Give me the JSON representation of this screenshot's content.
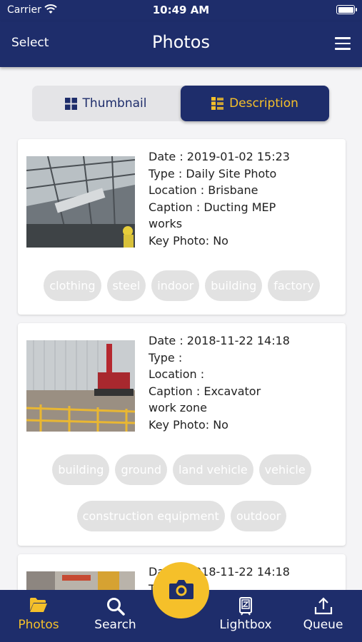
{
  "status_bar": {
    "carrier": "Carrier",
    "time": "10:49 AM"
  },
  "nav": {
    "left_label": "Select",
    "title": "Photos",
    "menu_icon": "hamburger-menu-icon"
  },
  "view_toggle": {
    "thumbnail_label": "Thumbnail",
    "description_label": "Description",
    "selected": "Description"
  },
  "photos": [
    {
      "date": "Date : 2019-01-02 15:23",
      "type": "Type : Daily Site Photo",
      "location": "Location : Brisbane",
      "caption_line1": "Caption : Ducting MEP",
      "caption_line2": "works",
      "key_photo": "Key Photo: No",
      "tags": [
        "clothing",
        "steel",
        "indoor",
        "building",
        "factory"
      ]
    },
    {
      "date": "Date : 2018-11-22 14:18",
      "type": "Type :",
      "location": "Location :",
      "caption_line1": "Caption : Excavator",
      "caption_line2": "work zone",
      "key_photo": "Key Photo: No",
      "tags": [
        "building",
        "ground",
        "land vehicle",
        "vehicle",
        "construction equipment",
        "outdoor"
      ]
    },
    {
      "date": "Date : 2018-11-22 14:18",
      "type": "Type :"
    }
  ],
  "tab_bar": {
    "photos": "Photos",
    "search": "Search",
    "lightbox": "Lightbox",
    "queue": "Queue",
    "active": "Photos"
  },
  "colors": {
    "brand": "#1e2d6b",
    "accent": "#f5c02a",
    "tag_bg": "#e2e2e2"
  }
}
